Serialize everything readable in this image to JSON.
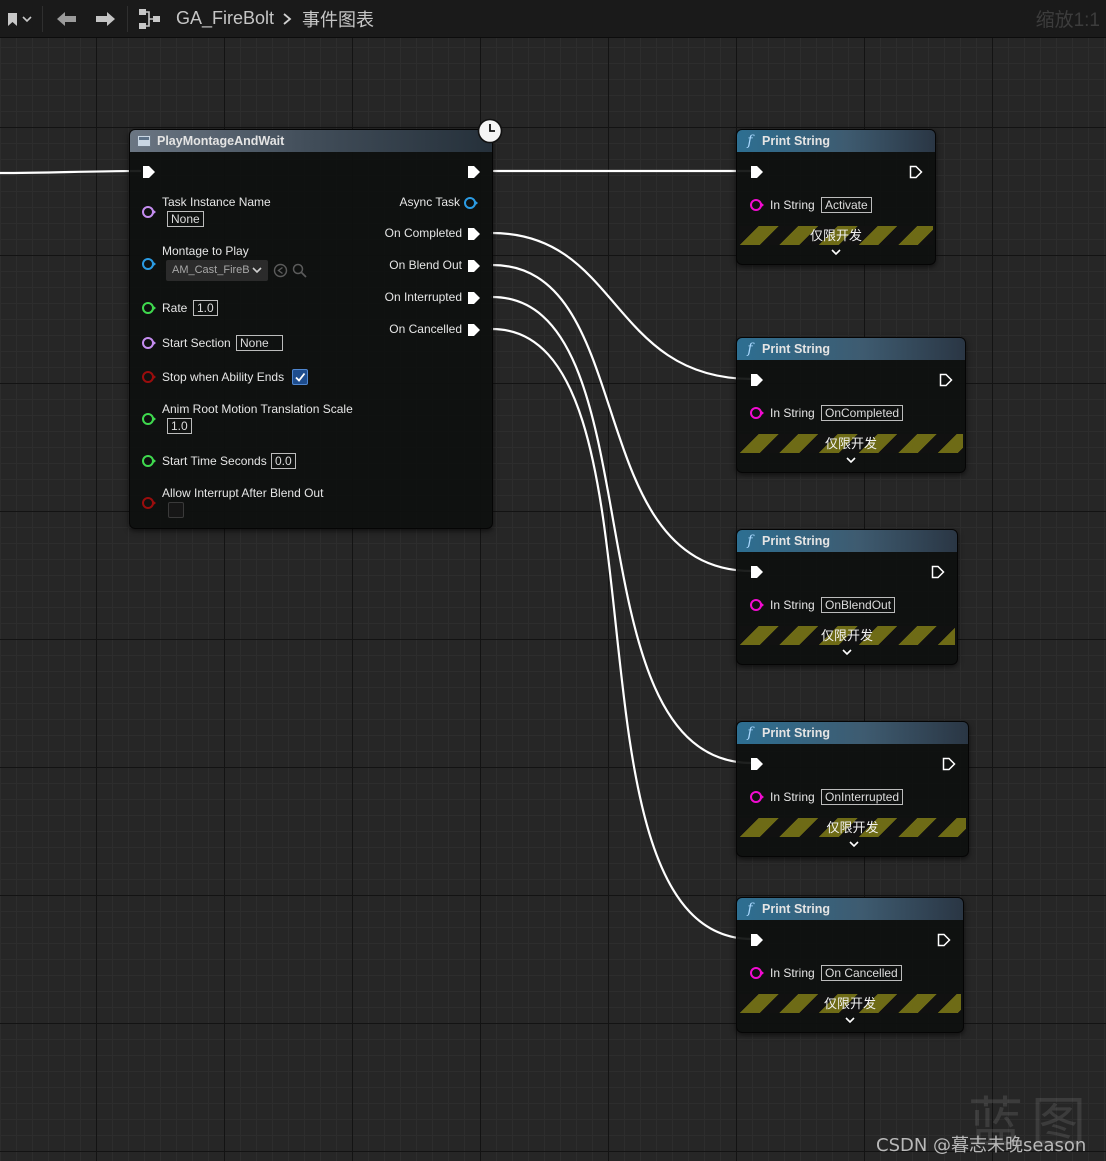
{
  "toolbar": {
    "breadcrumb_root": "GA_FireBolt",
    "breadcrumb_leaf": "事件图表",
    "zoom": "缩放1:1"
  },
  "montage_node": {
    "title": "PlayMontageAndWait",
    "inputs": {
      "task_instance_name": {
        "label": "Task Instance Name",
        "value": "None"
      },
      "montage_to_play": {
        "label": "Montage to Play",
        "value": "AM_Cast_FireB"
      },
      "rate": {
        "label": "Rate",
        "value": "1.0"
      },
      "start_section": {
        "label": "Start Section",
        "value": "None"
      },
      "stop_when_ability_ends": {
        "label": "Stop when Ability Ends",
        "checked": true
      },
      "anim_root_motion_scale": {
        "label": "Anim Root Motion Translation Scale",
        "value": "1.0"
      },
      "start_time_seconds": {
        "label": "Start Time Seconds",
        "value": "0.0"
      },
      "allow_interrupt_after_blend_out": {
        "label": "Allow Interrupt After Blend Out",
        "checked": false
      }
    },
    "outputs": {
      "async_task": "Async Task",
      "on_completed": "On Completed",
      "on_blend_out": "On Blend Out",
      "on_interrupted": "On Interrupted",
      "on_cancelled": "On Cancelled"
    }
  },
  "print_nodes": [
    {
      "title": "Print String",
      "in_string_label": "In String",
      "value": "Activate",
      "dev_label": "仅限开发"
    },
    {
      "title": "Print String",
      "in_string_label": "In String",
      "value": "OnCompleted",
      "dev_label": "仅限开发"
    },
    {
      "title": "Print String",
      "in_string_label": "In String",
      "value": "OnBlendOut",
      "dev_label": "仅限开发"
    },
    {
      "title": "Print String",
      "in_string_label": "In String",
      "value": "OnInterrupted",
      "dev_label": "仅限开发"
    },
    {
      "title": "Print String",
      "in_string_label": "In String",
      "value": "On Cancelled",
      "dev_label": "仅限开发"
    }
  ],
  "watermark": {
    "glyph": "蓝图",
    "credit": "CSDN @暮志未晚season"
  },
  "colors": {
    "exec_wire": "#ffffff",
    "string_pin": "#f10bd0",
    "name_pin": "#c58df0",
    "object_pin": "#2b9be3",
    "float_pin": "#3fd94e",
    "bool_pin": "#9a0d0d",
    "dev_stripe": "#6e6b16"
  }
}
